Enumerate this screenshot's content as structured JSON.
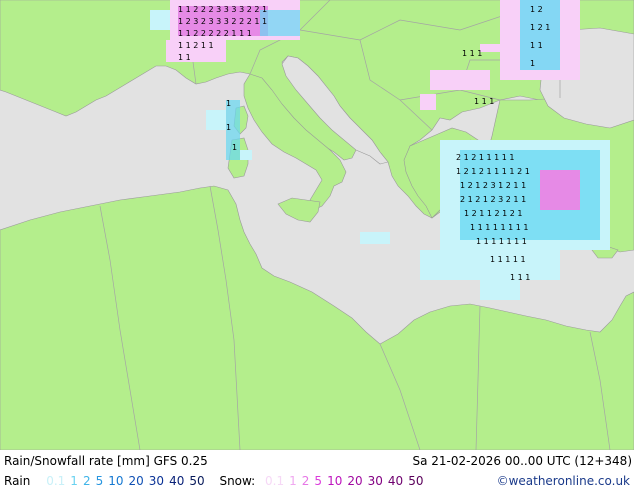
{
  "title": "Rain/Snowfall rate [mm]  GFS 0.25",
  "datetime": "Sa 21-02-2026 00..00 UTC (12+348)",
  "legend": {
    "rain_label": "Rain",
    "rain_values": [
      {
        "v": "0.1",
        "color": "#c8f0f8"
      },
      {
        "v": "1",
        "color": "#6ad2f0"
      },
      {
        "v": "2",
        "color": "#40b4e8"
      },
      {
        "v": "5",
        "color": "#2896e0"
      },
      {
        "v": "10",
        "color": "#1478d2"
      },
      {
        "v": "20",
        "color": "#1050b4"
      },
      {
        "v": "30",
        "color": "#0a3296"
      },
      {
        "v": "40",
        "color": "#0a2278"
      },
      {
        "v": "50",
        "color": "#081a5a"
      }
    ],
    "snow_label": "Snow:",
    "snow_values": [
      {
        "v": "0.1",
        "color": "#f6d8f6"
      },
      {
        "v": "1",
        "color": "#f0a8f0"
      },
      {
        "v": "2",
        "color": "#e676e6"
      },
      {
        "v": "5",
        "color": "#dc3cdc"
      },
      {
        "v": "10",
        "color": "#be14be"
      },
      {
        "v": "20",
        "color": "#a00aa0"
      },
      {
        "v": "30",
        "color": "#820082"
      },
      {
        "v": "40",
        "color": "#6e006e"
      },
      {
        "v": "50",
        "color": "#5a005a"
      }
    ]
  },
  "credit": "©weatheronline.co.uk",
  "colors": {
    "sea": "#e2e2e2",
    "land": "#b4ee8c",
    "border": "#9a9a9a",
    "rain_light": "#c8f4fa",
    "rain_mid": "#66d8f2",
    "snow_light": "#f8d0f8",
    "snow_mid": "#e68ae6"
  }
}
